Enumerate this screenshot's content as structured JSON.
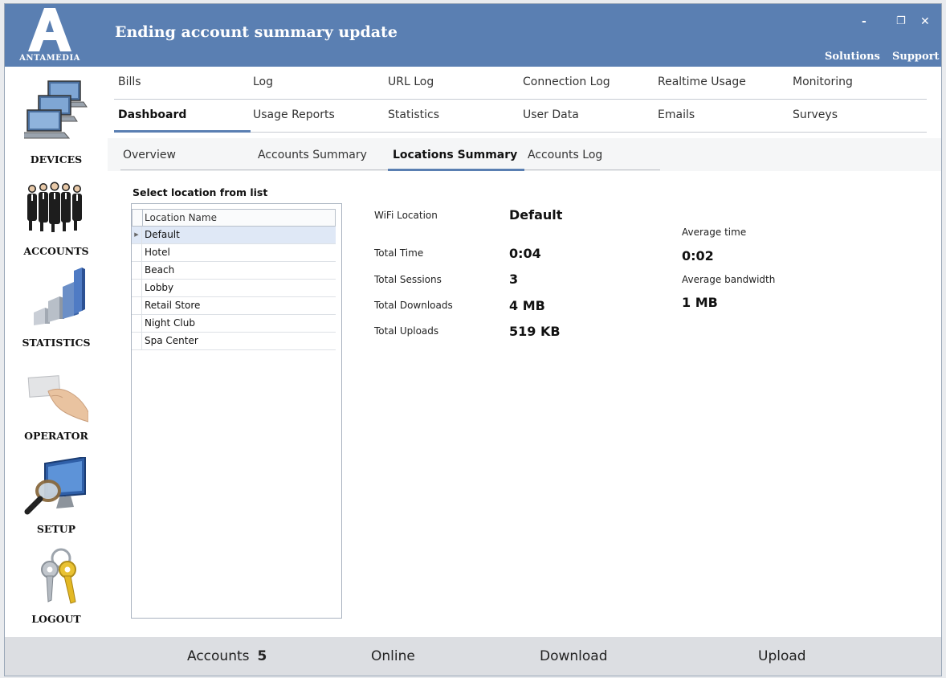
{
  "window": {
    "title": "Ending account summary update",
    "logo_text": "ANTAMEDIA",
    "controls": {
      "minimize": "-",
      "restore": "❐",
      "close": "✕"
    },
    "links": [
      "Solutions",
      "Support"
    ]
  },
  "sidebar": {
    "items": [
      {
        "label": "DEVICES",
        "icon": "computers-icon"
      },
      {
        "label": "ACCOUNTS",
        "icon": "people-icon"
      },
      {
        "label": "STATISTICS",
        "icon": "bar-chart-icon"
      },
      {
        "label": "OPERATOR",
        "icon": "hand-card-icon"
      },
      {
        "label": "SETUP",
        "icon": "monitor-magnifier-icon"
      },
      {
        "label": "LOGOUT",
        "icon": "keys-icon"
      }
    ]
  },
  "tabs": {
    "row1": [
      "Bills",
      "Log",
      "URL Log",
      "Connection Log",
      "Realtime Usage",
      "Monitoring"
    ],
    "row2": [
      "Dashboard",
      "Usage Reports",
      "Statistics",
      "User Data",
      "Emails",
      "Surveys"
    ],
    "active": "Dashboard"
  },
  "subtabs": {
    "items": [
      "Overview",
      "Accounts Summary",
      "Locations Summary",
      "Accounts Log"
    ],
    "active": "Locations Summary"
  },
  "locations": {
    "select_label": "Select location from list",
    "column_header": "Location Name",
    "rows": [
      "Default",
      "Hotel",
      "Beach",
      "Lobby",
      "Retail Store",
      "Night Club",
      "Spa Center"
    ],
    "selected": "Default"
  },
  "summary": {
    "wifi_location_label": "WiFi Location",
    "wifi_location_value": "Default",
    "total_time_label": "Total Time",
    "total_time_value": "0:04",
    "total_sessions_label": "Total Sessions",
    "total_sessions_value": "3",
    "total_downloads_label": "Total Downloads",
    "total_downloads_value": "4 MB",
    "total_uploads_label": "Total Uploads",
    "total_uploads_value": "519 KB",
    "average_time_label": "Average time",
    "average_time_value": "0:02",
    "average_bandwidth_label": "Average bandwidth",
    "average_bandwidth_value": "1 MB"
  },
  "footer": {
    "accounts_label": "Accounts",
    "accounts_value": "5",
    "online_label": "Online",
    "download_label": "Download",
    "upload_label": "Upload"
  },
  "colors": {
    "header": "#5a7fb2",
    "active_tab_underline": "#5a7fb2",
    "footer": "#dcdee2",
    "selected_row": "#dfe8f6"
  }
}
